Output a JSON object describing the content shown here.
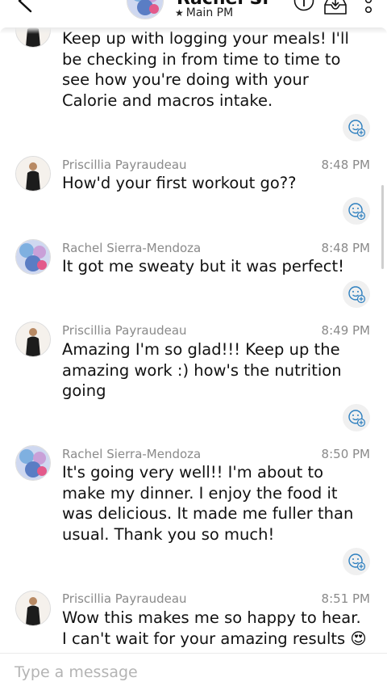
{
  "header": {
    "contact_name": "Rachel Si",
    "subtitle": "Main PM",
    "icons": [
      "back-arrow-icon",
      "chevron-down-icon",
      "info-icon",
      "inbox-icon",
      "more-vertical-icon"
    ]
  },
  "messages": [
    {
      "sender": "",
      "time": "",
      "text": "Keep up with logging your meals! I'll be checking in from time to time to see how you're doing with your Calorie and macros intake.",
      "avatar": "priscillia"
    },
    {
      "sender": "Priscillia Payraudeau",
      "time": "8:48 PM",
      "text": "How'd your first workout go??",
      "avatar": "priscillia"
    },
    {
      "sender": "Rachel Sierra-Mendoza",
      "time": "8:48 PM",
      "text": "It got me sweaty but it was perfect!",
      "avatar": "rachel"
    },
    {
      "sender": "Priscillia Payraudeau",
      "time": "8:49 PM",
      "text": "Amazing I'm so glad!!! Keep up the amazing work :) how's the nutrition going",
      "avatar": "priscillia"
    },
    {
      "sender": "Rachel Sierra-Mendoza",
      "time": "8:50 PM",
      "text": "It's going very well!! I'm about to make my dinner. I enjoy the food it was delicious. It made me fuller than usual. Thank you so much!",
      "avatar": "rachel"
    },
    {
      "sender": "Priscillia Payraudeau",
      "time": "8:51 PM",
      "text": "Wow this makes me so happy to hear. I can't wait for your amazing results",
      "emoji": "😍",
      "avatar": "priscillia"
    }
  ],
  "composer": {
    "placeholder": "Type a message"
  }
}
